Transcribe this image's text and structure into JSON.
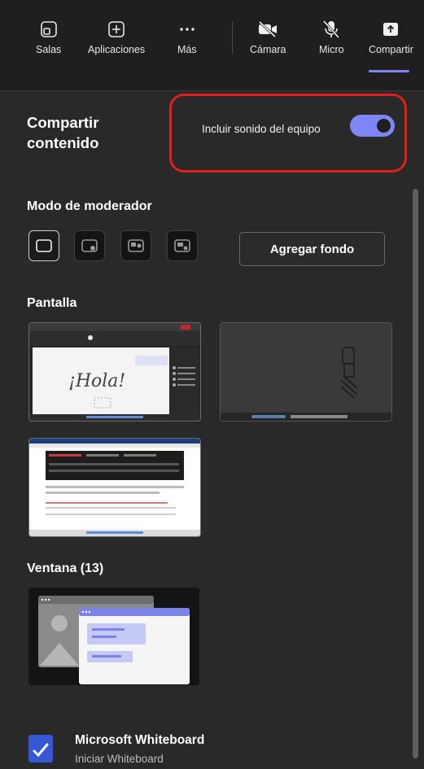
{
  "toolbar": {
    "items": [
      {
        "label": "Salas",
        "icon": "rooms-icon"
      },
      {
        "label": "Aplicaciones",
        "icon": "apps-icon"
      },
      {
        "label": "Más",
        "icon": "more-icon"
      },
      {
        "label": "Cámara",
        "icon": "camera-off-icon"
      },
      {
        "label": "Micro",
        "icon": "mic-off-icon"
      },
      {
        "label": "Compartir",
        "icon": "share-icon"
      }
    ],
    "active": "Compartir",
    "accent": "#7f85f5"
  },
  "share": {
    "title_line1": "Compartir",
    "title_line2": "contenido",
    "sound_label": "Incluir sonido del equipo",
    "sound_enabled": true,
    "highlight_color": "#e21b1b"
  },
  "presenter": {
    "title": "Modo de moderador",
    "modes": [
      "content-only",
      "standout",
      "side-by-side",
      "reporter"
    ],
    "selected_mode": "content-only",
    "add_background_label": "Agregar fondo"
  },
  "screens": {
    "title": "Pantalla",
    "handwriting": "¡Hola!"
  },
  "windows": {
    "title": "Ventana (13)"
  },
  "whiteboard": {
    "title": "Microsoft Whiteboard",
    "subtitle": "Iniciar Whiteboard"
  }
}
